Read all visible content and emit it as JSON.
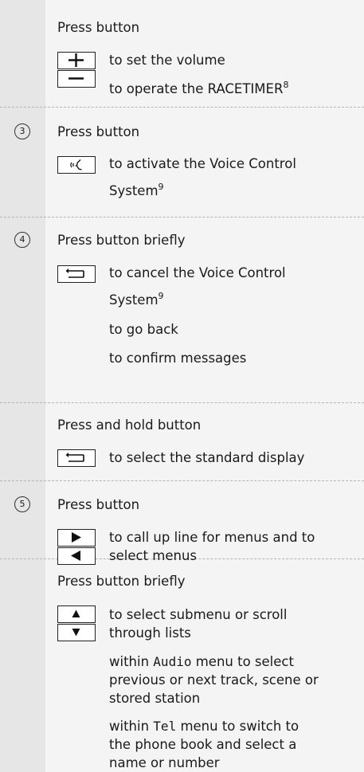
{
  "section1": {
    "press": "Press button",
    "plus_text": "to set the volume",
    "minus_text": "to operate the RACETIMER",
    "minus_footnote": "8"
  },
  "section2": {
    "number": "3",
    "press": "Press button",
    "voice_line1": "to activate the Voice Control",
    "voice_line2": "System",
    "voice_footnote": "9"
  },
  "section3": {
    "number": "4",
    "press": "Press button briefly",
    "back_line1": "to cancel the Voice Control",
    "back_line2": "System",
    "back_footnote": "9",
    "back_line3": "to go back",
    "back_line4": "to confirm messages"
  },
  "section4": {
    "press": "Press and hold button",
    "hold_text": "to select the standard display"
  },
  "section5": {
    "number": "5",
    "press": "Press button",
    "lr_line1": "to call up line for menus and to",
    "lr_line2": "select menus"
  },
  "section6": {
    "press": "Press button briefly",
    "ud_line1": "to select submenu or scroll",
    "ud_line2": "through lists",
    "audio_prefix": "within ",
    "audio_word": "Audio",
    "audio_suffix": " menu to select",
    "audio_line2": "previous or next track, scene or",
    "audio_line3": "stored station",
    "tel_prefix": "within ",
    "tel_word": "Tel",
    "tel_suffix": " menu to switch to",
    "tel_line2": "the phone book and select a",
    "tel_line3": "name or number"
  }
}
